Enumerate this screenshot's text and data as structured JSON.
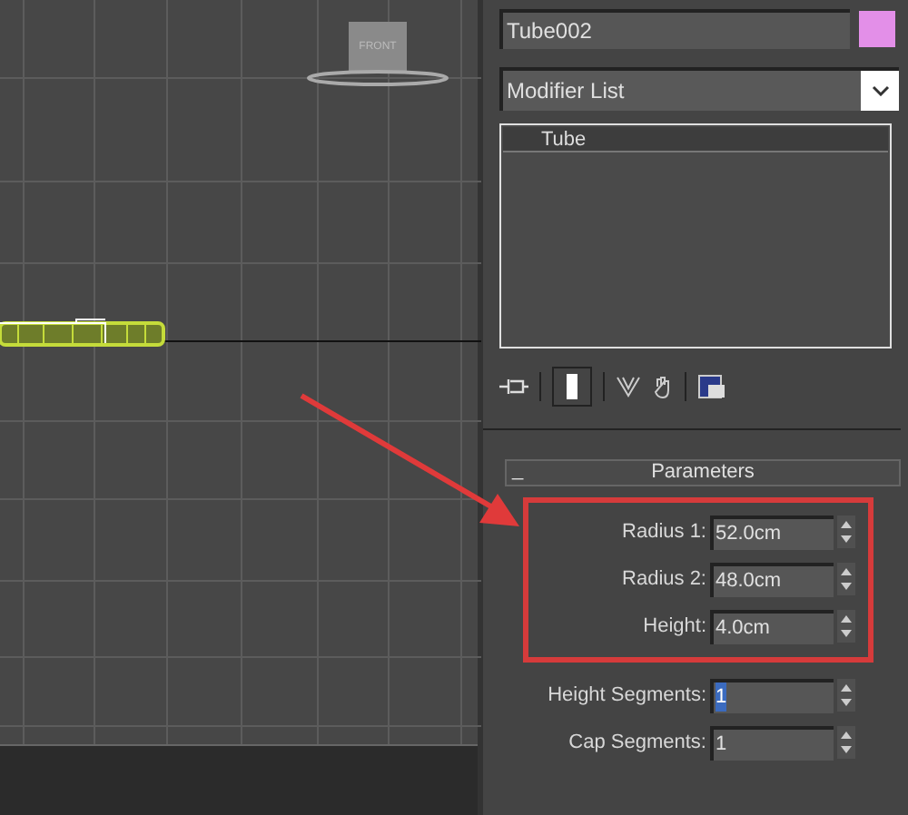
{
  "viewport": {
    "viewcube_label": "FRONT"
  },
  "object_name": {
    "value": "Tube002",
    "color": "#e38fe8"
  },
  "modifier_list": {
    "label": "Modifier List"
  },
  "modifier_stack": [
    {
      "label": "Tube",
      "selected": true
    }
  ],
  "parameters": {
    "title": "Parameters",
    "collapse": "_",
    "rows": [
      {
        "label": "Radius 1:",
        "value": "52.0cm",
        "selected": false
      },
      {
        "label": "Radius 2:",
        "value": "48.0cm",
        "selected": false
      },
      {
        "label": "Height:",
        "value": "4.0cm",
        "selected": false
      },
      {
        "label": "Height Segments:",
        "value": "1",
        "selected": true
      },
      {
        "label": "Cap Segments:",
        "value": "1",
        "selected": false
      }
    ]
  }
}
